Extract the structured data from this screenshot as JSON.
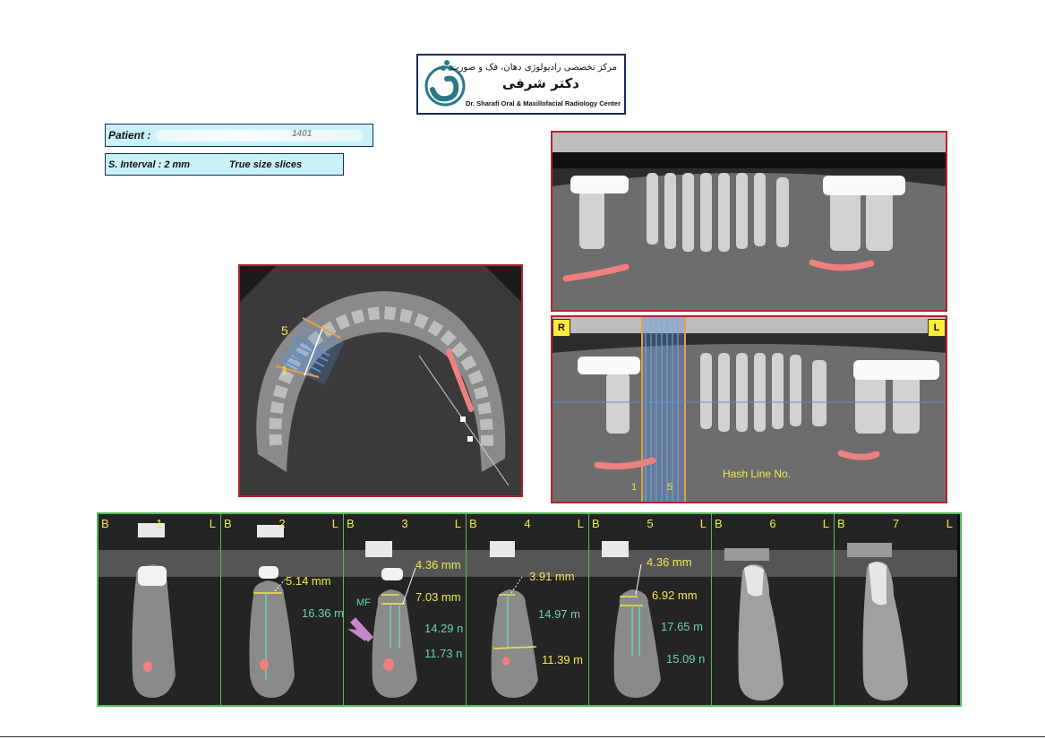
{
  "logo": {
    "fa_line1": "مرکز تخصصی رادیولوژی دهان، فک و صورت",
    "fa_line2": "دکتر شرفی",
    "en_line": "Dr. Sharafi Oral & Maxillofacial Radiology Center"
  },
  "patient": {
    "label": "Patient :",
    "value_obscured": "1401"
  },
  "scan_info": {
    "interval": "S.  Interval : 2 mm",
    "size": "True  size  slices"
  },
  "axial_view": {
    "hash_first": "1",
    "hash_last": "5"
  },
  "panoramic_view": {
    "right_tag": "R",
    "left_tag": "L",
    "hash_first": "1",
    "hash_last": "5",
    "hash_line_label": "Hash Line No."
  },
  "slices": [
    {
      "buccal": "B",
      "number": "1",
      "lingual": "L",
      "measurements": []
    },
    {
      "buccal": "B",
      "number": "2",
      "lingual": "L",
      "measurements": [
        "5.14 mm",
        "16.36 m"
      ]
    },
    {
      "buccal": "B",
      "number": "3",
      "lingual": "L",
      "mf_label": "MF",
      "measurements": [
        "4.36 mm",
        "7.03 mm",
        "14.29 n",
        "11.73 n"
      ]
    },
    {
      "buccal": "B",
      "number": "4",
      "lingual": "L",
      "measurements": [
        "3.91 mm",
        "14.97 m",
        "11.39 m"
      ]
    },
    {
      "buccal": "B",
      "number": "5",
      "lingual": "L",
      "measurements": [
        "4.36 mm",
        "6.92 mm",
        "17.65 m",
        "15.09 n"
      ]
    },
    {
      "buccal": "B",
      "number": "6",
      "lingual": "L",
      "measurements": []
    },
    {
      "buccal": "B",
      "number": "7",
      "lingual": "L",
      "measurements": []
    }
  ],
  "colors": {
    "frame_red": "#b0242b",
    "frame_green": "#59b55c",
    "label_yellow": "#f2e84c",
    "measure_green": "#6fd3a8",
    "info_fill": "#c9f1f9",
    "canal_mark": "#f08080"
  }
}
